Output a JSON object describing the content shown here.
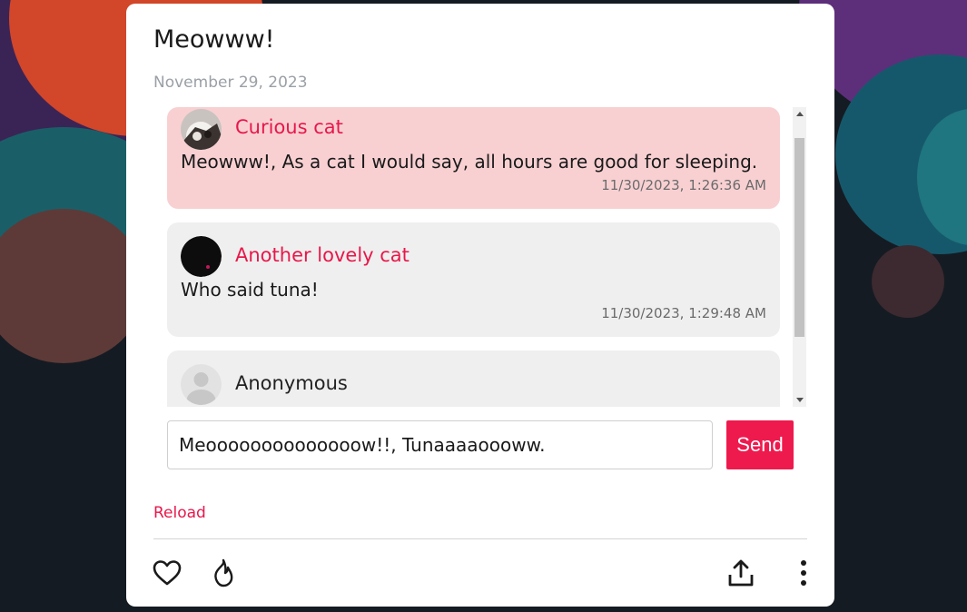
{
  "post": {
    "title": "Meowww!",
    "date": "November 29, 2023"
  },
  "comments": [
    {
      "author": "Curious cat",
      "text": "Meowww!, As a cat I would say, all hours are good for sleeping.",
      "time": "11/30/2023, 1:26:36 AM",
      "highlighted": true
    },
    {
      "author": "Another lovely cat",
      "text": "Who said tuna!",
      "time": "11/30/2023, 1:29:48 AM",
      "highlighted": false
    },
    {
      "author": "Anonymous",
      "highlighted": false
    }
  ],
  "composer": {
    "value": "Meoooooooooooooow!!, Tunaaaaoooww.",
    "send_label": "Send"
  },
  "reload_label": "Reload",
  "actions": {
    "like_icon": "heart-icon",
    "fire_icon": "flame-icon",
    "share_icon": "share-icon",
    "more_icon": "more-vertical-icon"
  },
  "colors": {
    "accent": "#ee1a4d",
    "highlight_background": "#f8d0d2",
    "comment_background": "#efefef"
  }
}
